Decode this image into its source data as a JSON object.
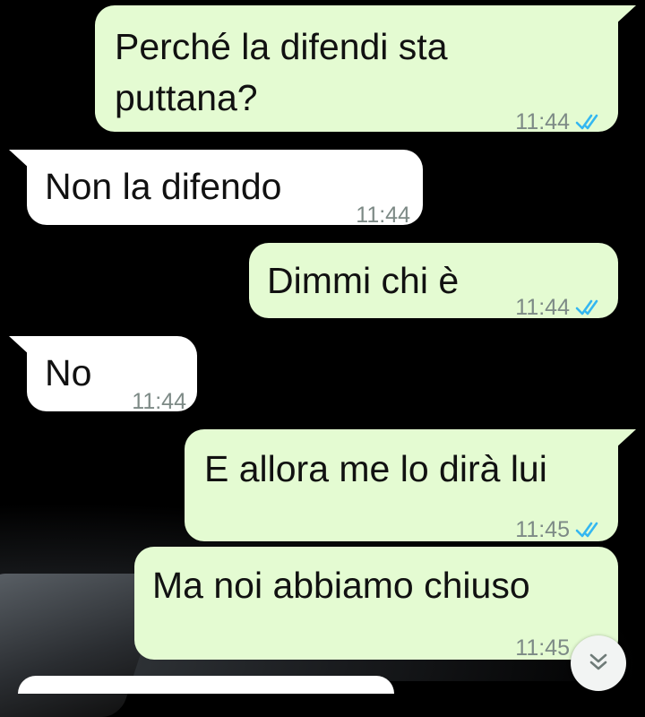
{
  "messages": [
    {
      "direction": "outgoing",
      "lines": [
        "Perché la difendi sta",
        "puttana?"
      ],
      "time": "11:44",
      "status": "read"
    },
    {
      "direction": "incoming",
      "lines": [
        "Non la difendo"
      ],
      "time": "11:44"
    },
    {
      "direction": "outgoing",
      "lines": [
        "Dimmi chi è"
      ],
      "time": "11:44",
      "status": "read"
    },
    {
      "direction": "incoming",
      "lines": [
        "No"
      ],
      "time": "11:44"
    },
    {
      "direction": "outgoing",
      "lines": [
        "E allora me lo dirà lui"
      ],
      "time": "11:45",
      "status": "read"
    },
    {
      "direction": "outgoing",
      "lines": [
        "Ma noi abbiamo chiuso"
      ],
      "time": "11:45",
      "status": "read"
    }
  ],
  "colors": {
    "outgoing_bubble": "#e4fbd2",
    "incoming_bubble": "#ffffff",
    "read_ticks": "#34b7f1",
    "timestamp": "#7d8a86"
  },
  "icons": {
    "read_status": "double-check-icon",
    "scroll_down": "double-chevron-down-icon"
  }
}
